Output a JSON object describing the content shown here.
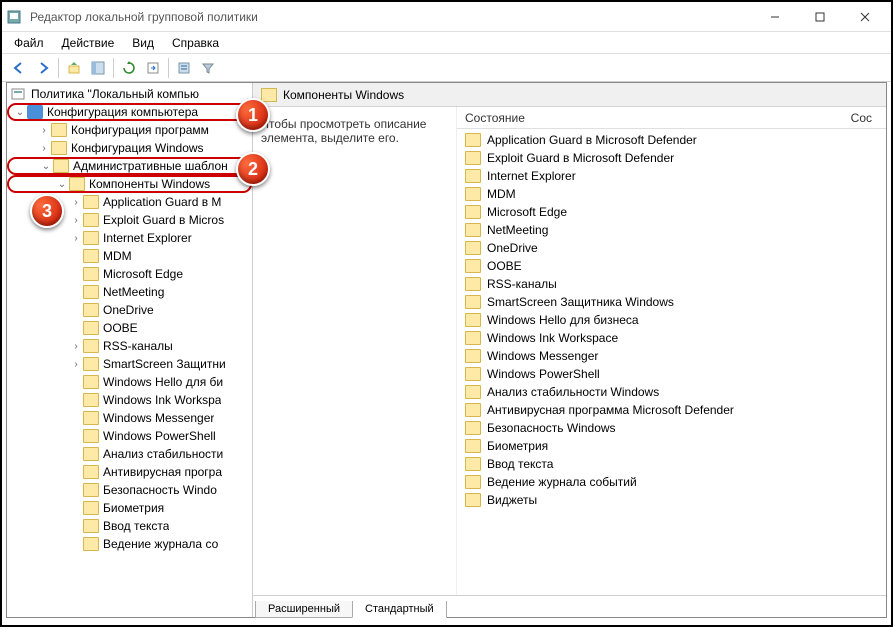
{
  "window": {
    "title": "Редактор локальной групповой политики"
  },
  "menu": {
    "file": "Файл",
    "action": "Действие",
    "view": "Вид",
    "help": "Справка"
  },
  "tree": {
    "root": "Политика \"Локальный компью",
    "n1": "Конфигурация компьютера",
    "n1_1": "Конфигурация программ",
    "n1_2": "Конфигурация Windows",
    "n1_3": "Административные шаблон",
    "n1_3_1": "Компоненты Windows",
    "items": [
      "Application Guard в M",
      "Exploit Guard в Micros",
      "Internet Explorer",
      "MDM",
      "Microsoft Edge",
      "NetMeeting",
      "OneDrive",
      "OOBE",
      "RSS-каналы",
      "SmartScreen Защитни",
      "Windows Hello для би",
      "Windows Ink Workspa",
      "Windows Messenger",
      "Windows PowerShell",
      "Анализ стабильности",
      "Антивирусная програ",
      "Безопасность Windo",
      "Биометрия",
      "Ввод текста",
      "Ведение журнала со"
    ]
  },
  "detail": {
    "header": "Компоненты Windows",
    "hint": "Чтобы просмотреть описание элемента, выделите его.",
    "col1": "Состояние",
    "col2": "Сос",
    "items": [
      "Application Guard в Microsoft Defender",
      "Exploit Guard в Microsoft Defender",
      "Internet Explorer",
      "MDM",
      "Microsoft Edge",
      "NetMeeting",
      "OneDrive",
      "OOBE",
      "RSS-каналы",
      "SmartScreen Защитника Windows",
      "Windows Hello для бизнеса",
      "Windows Ink Workspace",
      "Windows Messenger",
      "Windows PowerShell",
      "Анализ стабильности Windows",
      "Антивирусная программа Microsoft Defender",
      "Безопасность Windows",
      "Биометрия",
      "Ввод текста",
      "Ведение журнала событий",
      "Виджеты"
    ]
  },
  "tabs": {
    "extended": "Расширенный",
    "standard": "Стандартный"
  },
  "callouts": {
    "c1": "1",
    "c2": "2",
    "c3": "3"
  }
}
